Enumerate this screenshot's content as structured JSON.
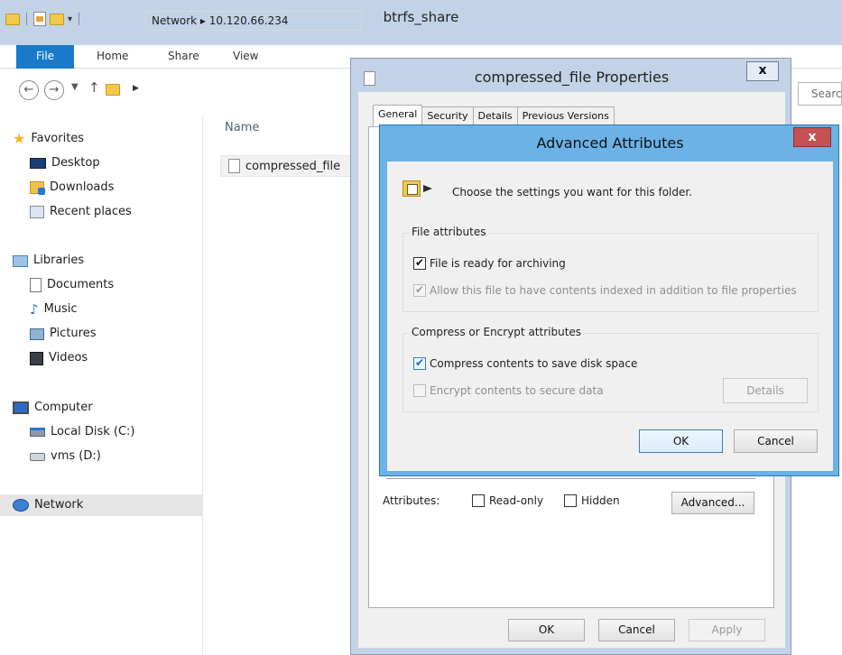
{
  "explorer": {
    "title": "btrfs_share",
    "ribbon_tabs": {
      "file": "File",
      "home": "Home",
      "share": "Share",
      "view": "View"
    },
    "address": "Network  ▸  10.120.66.234",
    "search_placeholder": "Searc",
    "column_name": "Name",
    "file_name": "compressed_file",
    "nav": {
      "favorites": "Favorites",
      "desktop": "Desktop",
      "downloads": "Downloads",
      "recent": "Recent places",
      "libraries": "Libraries",
      "documents": "Documents",
      "music": "Music",
      "pictures": "Pictures",
      "videos": "Videos",
      "computer": "Computer",
      "local_disk": "Local Disk (C:)",
      "vms": "vms (D:)",
      "network": "Network"
    }
  },
  "properties": {
    "title": "compressed_file Properties",
    "close": "x",
    "tabs": {
      "general": "General",
      "security": "Security",
      "details": "Details",
      "previous": "Previous Versions"
    },
    "attributes_label": "Attributes:",
    "read_only": "Read-only",
    "hidden": "Hidden",
    "advanced_button": "Advanced...",
    "ok": "OK",
    "cancel": "Cancel",
    "apply": "Apply"
  },
  "advanced": {
    "title": "Advanced Attributes",
    "close": "x",
    "intro": "Choose the settings you want for this folder.",
    "file_attributes_label": "File attributes",
    "archive": "File is ready for archiving",
    "index": "Allow this file to have contents indexed in addition to file properties",
    "compress_group_label": "Compress or Encrypt attributes",
    "compress": "Compress contents to save disk space",
    "encrypt": "Encrypt contents to secure data",
    "details_button": "Details",
    "ok": "OK",
    "cancel": "Cancel"
  }
}
